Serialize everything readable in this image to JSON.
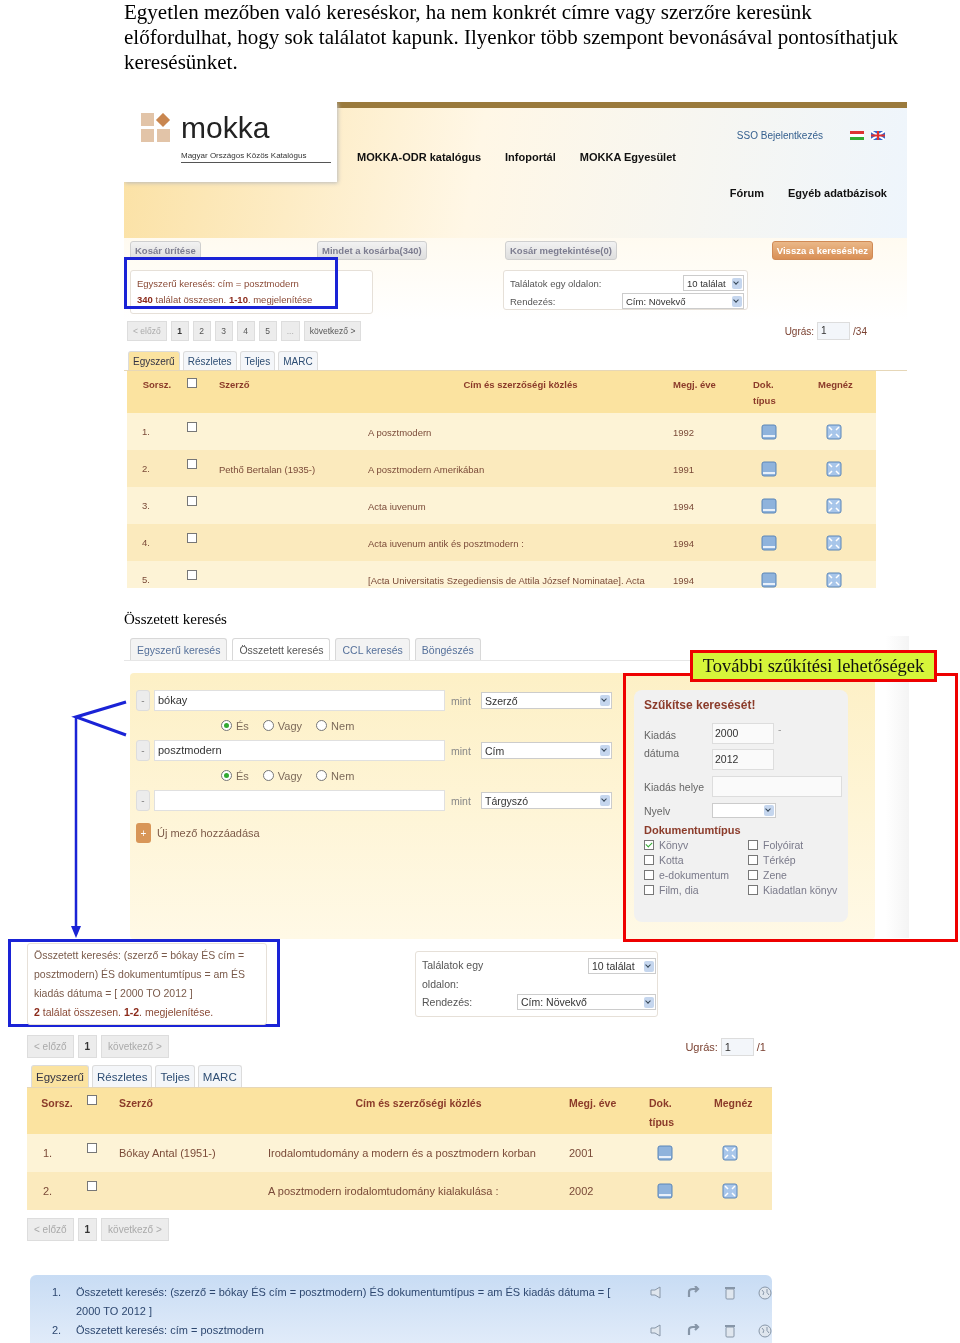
{
  "intro": "Egyetlen mezőben való kereséskor, ha nem konkrét címre vagy szerzőre keresünk\nelőfordulhat, hogy sok találatot kapunk. Ilyenkor több szempont bevonásával pontosíthatjuk keresésünket.",
  "results_page": {
    "logo": {
      "name": "mokka",
      "subtitle": "Magyar Országos Közös Katalógus"
    },
    "login": "SSO Bejelentkezés",
    "nav": [
      "MOKKA-ODR katalógus",
      "Infoportál",
      "MOKKA Egyesület"
    ],
    "nav_right": [
      "Fórum",
      "Egyéb adatbázisok"
    ],
    "buttons": [
      {
        "label": "Kosár ürítése",
        "kind": "plain"
      },
      {
        "label": "Mindet a kosárba(340)",
        "kind": "plain"
      },
      {
        "label": "Kosár megtekintése(0)",
        "kind": "plain"
      },
      {
        "label": "Vissza a kereséshez",
        "kind": "accent"
      }
    ],
    "summary": {
      "query": "Egyszerű keresés: cím = posztmodern",
      "result": "**340** találat összesen. **1-10**. megjelenítése"
    },
    "settings": {
      "per_page_label": "Találatok egy oldalon:",
      "per_page_value": "10 találat",
      "sort_label": "Rendezés:",
      "sort_value": "Cím: Növekvő"
    },
    "pagination": [
      {
        "label": "< előző",
        "selected": false,
        "disabled": true
      },
      {
        "label": "1",
        "selected": true,
        "disabled": false
      },
      {
        "label": "2",
        "selected": false,
        "disabled": false
      },
      {
        "label": "3",
        "selected": false,
        "disabled": false
      },
      {
        "label": "4",
        "selected": false,
        "disabled": false
      },
      {
        "label": "5",
        "selected": false,
        "disabled": false
      },
      {
        "label": "...",
        "selected": false,
        "disabled": true
      },
      {
        "label": "következő >",
        "selected": false,
        "disabled": false
      }
    ],
    "jump": {
      "label": "Ugrás:",
      "value": "1",
      "total": "/34"
    },
    "tabs": [
      {
        "label": "Egyszerű",
        "selected": true
      },
      {
        "label": "Részletes",
        "selected": false
      },
      {
        "label": "Teljes",
        "selected": false
      },
      {
        "label": "MARC",
        "selected": false
      }
    ],
    "table": {
      "columns": [
        "Sorsz.",
        "Szerző",
        "Cím és szerzőségi közlés",
        "Megj. éve",
        "Dok. típus",
        "Megnéz"
      ],
      "select_all_checked": false,
      "rows": [
        {
          "number": "1.",
          "checked": false,
          "title": "A posztmodern",
          "year": "1992"
        },
        {
          "number": "2.",
          "checked": false,
          "author": "Pethő Bertalan (1935-)",
          "title": "A posztmodern Amerikában",
          "year": "1991"
        },
        {
          "number": "3.",
          "checked": false,
          "title": "Acta iuvenum",
          "year": "1994"
        },
        {
          "number": "4.",
          "checked": false,
          "title": "Acta iuvenum antik és posztmodern :",
          "year": "1994"
        },
        {
          "number": "5.",
          "checked": false,
          "title": "[Acta Universitatis Szegediensis de Attila József Nominatae]. Acta",
          "year": "1994"
        }
      ]
    }
  },
  "caption": "Összetett keresés",
  "advanced_search": {
    "tabs": [
      {
        "label": "Egyszerű keresés",
        "selected": false
      },
      {
        "label": "Összetett keresés",
        "selected": true
      },
      {
        "label": "CCL keresés",
        "selected": false
      },
      {
        "label": "Böngészés",
        "selected": false
      }
    ],
    "criteria": [
      {
        "remove": "-",
        "value": "bókay",
        "connector": "mint",
        "field": "Szerző",
        "operators": [
          {
            "label": "És",
            "selected": true
          },
          {
            "label": "Vagy",
            "selected": false
          },
          {
            "label": "Nem",
            "selected": false
          }
        ]
      },
      {
        "remove": "-",
        "value": "posztmodern",
        "connector": "mint",
        "field": "Cím",
        "operators": [
          {
            "label": "És",
            "selected": true
          },
          {
            "label": "Vagy",
            "selected": false
          },
          {
            "label": "Nem",
            "selected": false
          }
        ]
      },
      {
        "remove": "-",
        "connector": "mint",
        "field": "Tárgyszó"
      }
    ],
    "add": {
      "icon": "+",
      "label": "Új mező hozzáadása"
    },
    "narrow": {
      "title": "Szűkítse keresését!",
      "date_label": "Kiadás dátuma",
      "date_from": "2000",
      "date_sep": "-",
      "date_to": "2012",
      "place_label": "Kiadás helye",
      "language_label": "Nyelv",
      "doc_type_title": "Dokumentumtípus",
      "doc_types": [
        {
          "label": "Könyv",
          "checked": true
        },
        {
          "label": "Folyóirat",
          "checked": false
        },
        {
          "label": "Kotta",
          "checked": false
        },
        {
          "label": "Térkép",
          "checked": false
        },
        {
          "label": "e-dokumentum",
          "checked": false
        },
        {
          "label": "Zene",
          "checked": false
        },
        {
          "label": "Film, dia",
          "checked": false
        },
        {
          "label": "Kiadatlan könyv",
          "checked": false
        }
      ]
    }
  },
  "callout": "További szűkítési lehetőségek",
  "advanced_results": {
    "summary": {
      "query": "Összetett keresés: (szerző = bókay ÉS cím = posztmodern) ÉS dokumentumtípus = am ÉS kiadás dátuma = [ 2000 TO 2012 ]",
      "result": "**2** találat összesen. **1-2**. megjelenítése."
    },
    "settings": {
      "per_page_label": "Találatok egy oldalon:",
      "per_page_value": "10 találat",
      "sort_label": "Rendezés:",
      "sort_value": "Cím: Növekvő"
    },
    "pagination": [
      {
        "label": "< előző",
        "selected": false,
        "disabled": true
      },
      {
        "label": "1",
        "selected": true,
        "disabled": false
      },
      {
        "label": "következő >",
        "selected": false,
        "disabled": true
      }
    ],
    "jump": {
      "label": "Ugrás:",
      "value": "1",
      "total": "/1"
    },
    "tabs": [
      {
        "label": "Egyszerű",
        "selected": true
      },
      {
        "label": "Részletes",
        "selected": false
      },
      {
        "label": "Teljes",
        "selected": false
      },
      {
        "label": "MARC",
        "selected": false
      }
    ],
    "table": {
      "columns": [
        "Sorsz.",
        "Szerző",
        "Cím és szerzőségi közlés",
        "Megj. éve",
        "Dok. típus",
        "Megnéz"
      ],
      "select_all_checked": false,
      "rows": [
        {
          "number": "1.",
          "checked": false,
          "author": "Bókay Antal (1951-)",
          "title": "Irodalomtudomány a modern és a posztmodern korban",
          "year": "2001"
        },
        {
          "number": "2.",
          "checked": false,
          "title": "A posztmodern irodalomtudomány kialakulása :",
          "year": "2002"
        }
      ]
    },
    "pagination_bottom": [
      {
        "label": "< előző",
        "selected": false,
        "disabled": true
      },
      {
        "label": "1",
        "selected": true,
        "disabled": false
      },
      {
        "label": "következő >",
        "selected": false,
        "disabled": true
      }
    ]
  },
  "search_history": [
    {
      "number": "1.",
      "text": "Összetett keresés: (szerző = bókay ÉS cím = posztmodern) ÉS dokumentumtípus = am ÉS kiadás dátuma = [ 2000 TO 2012 ]"
    },
    {
      "number": "2.",
      "text": "Összetett keresés: cím = posztmodern"
    }
  ]
}
